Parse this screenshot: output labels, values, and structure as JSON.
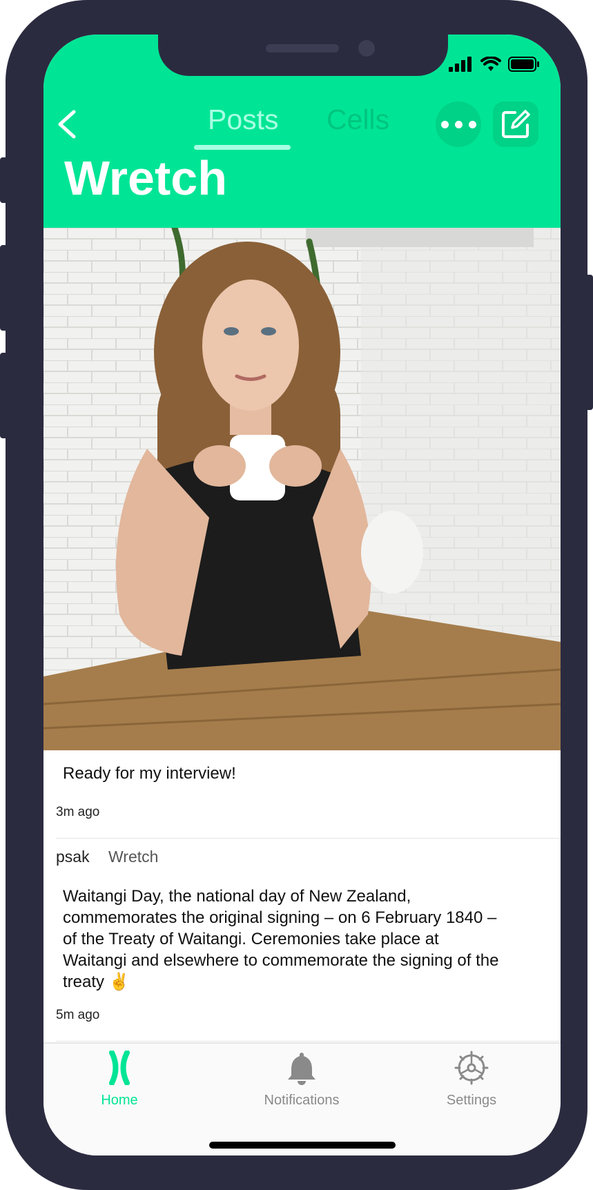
{
  "header": {
    "tabs": [
      {
        "label": "Posts",
        "active": true
      },
      {
        "label": "Cells",
        "active": false
      }
    ],
    "title": "Wretch",
    "icons": {
      "back": "chevron-left-icon",
      "more": "ellipsis-icon",
      "compose": "compose-icon"
    }
  },
  "colors": {
    "accent": "#00e595",
    "frame": "#2b2b40",
    "tab_active": "#a8ffe3"
  },
  "posts": [
    {
      "text": "Ready for my interview!",
      "time": "3m ago"
    },
    {
      "author": "psak",
      "cell": "Wretch",
      "text": "Waitangi Day, the national day of New Zealand, commemorates the original signing – on 6 February 1840 – of the Treaty of Waitangi. Ceremonies take place at Waitangi and elsewhere to commemorate the signing of the treaty ✌️",
      "time": "5m ago"
    }
  ],
  "tabbar": [
    {
      "label": "Home",
      "icon": "chromosome-icon",
      "active": true
    },
    {
      "label": "Notifications",
      "icon": "bell-icon",
      "active": false
    },
    {
      "label": "Settings",
      "icon": "gear-icon",
      "active": false
    }
  ]
}
